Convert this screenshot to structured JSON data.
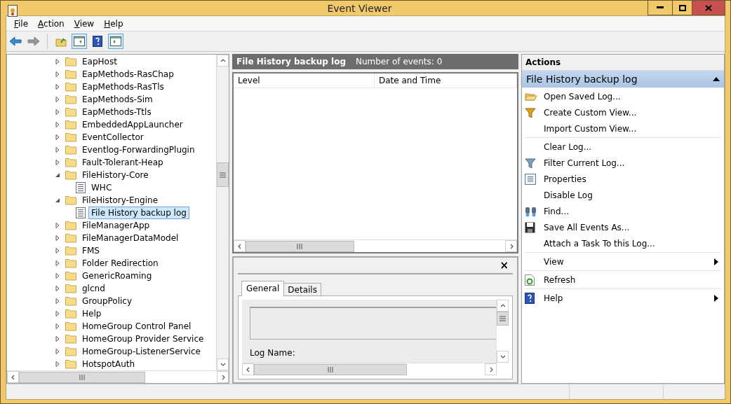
{
  "window": {
    "title": "Event Viewer"
  },
  "menu": [
    {
      "label": "File"
    },
    {
      "label": "Action"
    },
    {
      "label": "View"
    },
    {
      "label": "Help"
    }
  ],
  "toolbar": [
    {
      "kind": "back",
      "disabled": false
    },
    {
      "kind": "forward",
      "disabled": true
    },
    {
      "kind": "up",
      "disabled": false
    },
    {
      "kind": "tree",
      "disabled": false
    },
    {
      "kind": "help",
      "disabled": false
    },
    {
      "kind": "actions",
      "disabled": false
    }
  ],
  "tree": [
    {
      "label": "EapHost",
      "kind": "folder",
      "expanded": false,
      "selected": false
    },
    {
      "label": "EapMethods-RasChap",
      "kind": "folder",
      "expanded": false,
      "selected": false
    },
    {
      "label": "EapMethods-RasTls",
      "kind": "folder",
      "expanded": false,
      "selected": false
    },
    {
      "label": "EapMethods-Sim",
      "kind": "folder",
      "expanded": false,
      "selected": false
    },
    {
      "label": "EapMethods-Ttls",
      "kind": "folder",
      "expanded": false,
      "selected": false
    },
    {
      "label": "EmbeddedAppLauncher",
      "kind": "folder",
      "expanded": false,
      "selected": false
    },
    {
      "label": "EventCollector",
      "kind": "folder",
      "expanded": false,
      "selected": false
    },
    {
      "label": "Eventlog-ForwardingPlugin",
      "kind": "folder",
      "expanded": false,
      "selected": false
    },
    {
      "label": "Fault-Tolerant-Heap",
      "kind": "folder",
      "expanded": false,
      "selected": false
    },
    {
      "label": "FileHistory-Core",
      "kind": "folder",
      "expanded": true,
      "selected": false,
      "children": [
        {
          "label": "WHC",
          "kind": "log",
          "selected": false
        }
      ]
    },
    {
      "label": "FileHistory-Engine",
      "kind": "folder",
      "expanded": true,
      "selected": false,
      "children": [
        {
          "label": "File History backup log",
          "kind": "log",
          "selected": true
        }
      ]
    },
    {
      "label": "FileManagerApp",
      "kind": "folder",
      "expanded": false,
      "selected": false
    },
    {
      "label": "FileManagerDataModel",
      "kind": "folder",
      "expanded": false,
      "selected": false
    },
    {
      "label": "FMS",
      "kind": "folder",
      "expanded": false,
      "selected": false
    },
    {
      "label": "Folder Redirection",
      "kind": "folder",
      "expanded": false,
      "selected": false
    },
    {
      "label": "GenericRoaming",
      "kind": "folder",
      "expanded": false,
      "selected": false
    },
    {
      "label": "glcnd",
      "kind": "folder",
      "expanded": false,
      "selected": false
    },
    {
      "label": "GroupPolicy",
      "kind": "folder",
      "expanded": false,
      "selected": false
    },
    {
      "label": "Help",
      "kind": "folder",
      "expanded": false,
      "selected": false
    },
    {
      "label": "HomeGroup Control Panel",
      "kind": "folder",
      "expanded": false,
      "selected": false
    },
    {
      "label": "HomeGroup Provider Service",
      "kind": "folder",
      "expanded": false,
      "selected": false
    },
    {
      "label": "HomeGroup-ListenerService",
      "kind": "folder",
      "expanded": false,
      "selected": false
    },
    {
      "label": "HotspotAuth",
      "kind": "folder",
      "expanded": false,
      "selected": false
    }
  ],
  "log_header": {
    "title": "File History backup log",
    "count": "Number of events: 0"
  },
  "table": {
    "columns": [
      "Level",
      "Date and Time"
    ]
  },
  "preview": {
    "close": "×",
    "tabs": [
      {
        "label": "General",
        "selected": true
      },
      {
        "label": "Details",
        "selected": false
      }
    ],
    "field_label": "Log Name:"
  },
  "actions": {
    "title": "Actions",
    "section": {
      "title": "File History backup log",
      "expanded": true
    },
    "groups": [
      [
        {
          "label": "Open Saved Log..."
        },
        {
          "label": "Create Custom View..."
        },
        {
          "label": "Import Custom View..."
        }
      ],
      [
        {
          "label": "Clear Log..."
        },
        {
          "label": "Filter Current Log..."
        },
        {
          "label": "Properties"
        },
        {
          "label": "Disable Log"
        },
        {
          "label": "Find..."
        },
        {
          "label": "Save All Events As..."
        },
        {
          "label": "Attach a Task To this Log..."
        }
      ],
      [
        {
          "label": "View",
          "submenu": true
        }
      ],
      [
        {
          "label": "Refresh"
        }
      ],
      [
        {
          "label": "Help",
          "submenu": true
        }
      ]
    ]
  }
}
